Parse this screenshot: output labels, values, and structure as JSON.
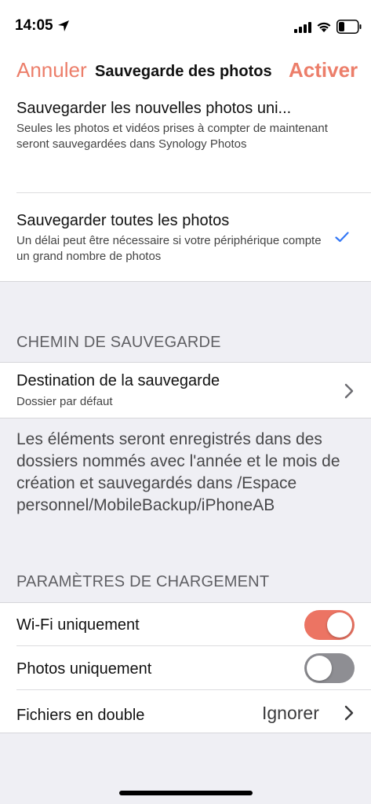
{
  "status_bar": {
    "time": "14:05"
  },
  "nav": {
    "cancel_label": "Annuler",
    "title": "Sauvegarde des photos",
    "activate_label": "Activer"
  },
  "options": [
    {
      "title": "Sauvegarder les nouvelles photos uni...",
      "description": "Seules les photos et vidéos prises à compter de maintenant seront sauvegardées dans Synology Photos",
      "selected": false
    },
    {
      "title": "Sauvegarder toutes les photos",
      "description": "Un délai peut être nécessaire si votre périphérique compte un grand nombre de photos",
      "selected": true
    }
  ],
  "backup_path": {
    "header": "CHEMIN DE SAUVEGARDE",
    "destination_title": "Destination de la sauvegarde",
    "destination_value": "Dossier par défaut",
    "info": "Les éléments seront enregistrés dans des dossiers nommés avec l'année et le mois de création et sauvegardés dans /Espace personnel/MobileBackup/iPhoneAB"
  },
  "upload_settings": {
    "header": "PARAMÈTRES DE CHARGEMENT",
    "wifi_only": {
      "label": "Wi-Fi uniquement",
      "on": true
    },
    "photos_only": {
      "label": "Photos uniquement",
      "on": false
    },
    "duplicates": {
      "label": "Fichiers en double",
      "value": "Ignorer"
    }
  },
  "colors": {
    "accent": "#ec7e6a",
    "toggle_on": "#ec7463",
    "toggle_off": "#8e8e93",
    "checkmark": "#3478f6",
    "background": "#efeff4"
  }
}
